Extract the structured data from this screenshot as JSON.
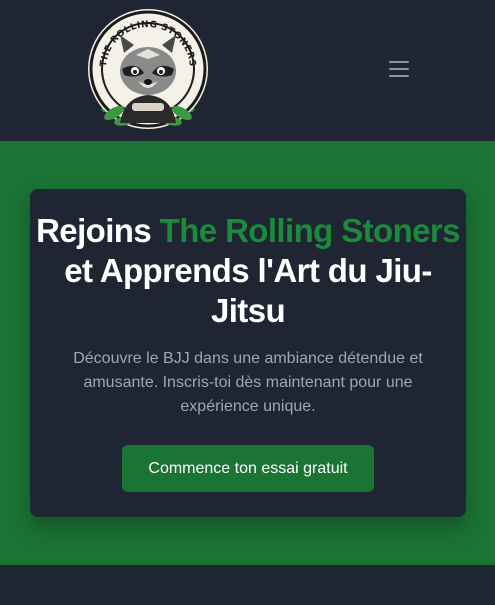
{
  "brand": {
    "logo_text": "THE ROLLING STONERS",
    "logo_icon": "raccoon-mascot-logo"
  },
  "header": {
    "menu_icon": "hamburger-menu-icon"
  },
  "hero": {
    "headline_part1": "Rejoins ",
    "headline_accent": "The Rolling Stoners",
    "headline_part2": " et Apprends l'Art du Jiu-Jitsu",
    "subtitle": "Découvre le BJJ dans une ambiance détendue et amusante. Inscris-toi dès maintenant pour une expérience unique.",
    "cta_label": "Commence ton essai gratuit"
  },
  "colors": {
    "page_background": "#1f2532",
    "hero_background": "#1a7434",
    "accent_text": "#1a8a3b",
    "heading_text": "#ffffff",
    "body_text": "#a0a6b2"
  }
}
